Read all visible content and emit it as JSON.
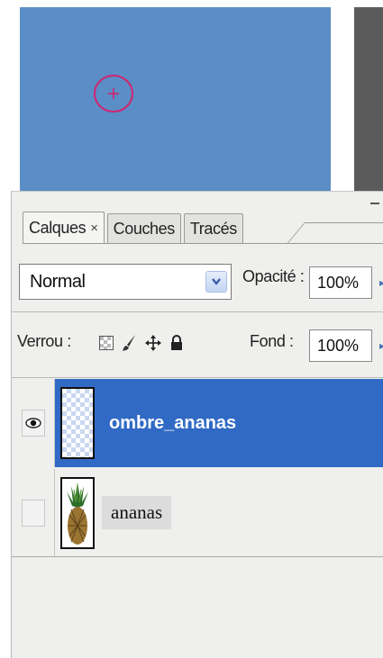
{
  "panel": {
    "tabs": [
      {
        "label": "Calques",
        "close": "×"
      },
      {
        "label": "Couches"
      },
      {
        "label": "Tracés"
      }
    ]
  },
  "blend": {
    "mode": "Normal",
    "opacity_label": "Opacité :",
    "opacity_value": "100%"
  },
  "lock": {
    "label": "Verrou :",
    "icons": [
      "lock-transparent-icon",
      "lock-paint-brush-icon",
      "lock-move-icon",
      "lock-all-icon"
    ],
    "fill_label": "Fond :",
    "fill_value": "100%"
  },
  "layers": [
    {
      "name": "ombre_ananas",
      "visible": true,
      "selected": true,
      "thumbnail": "transparent-checker"
    },
    {
      "name": "ananas",
      "visible": false,
      "selected": false,
      "thumbnail": "pineapple-image"
    }
  ],
  "colors": {
    "canvas": "#5b8dc6",
    "selection": "#316ac5",
    "brush_cursor": "#d2246f",
    "panel_bg": "#efefed"
  }
}
